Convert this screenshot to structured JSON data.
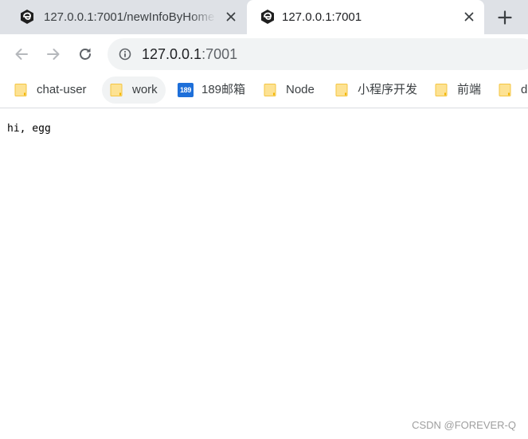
{
  "tabs": [
    {
      "title": "127.0.0.1:7001/newInfoByHome",
      "favicon": "egg-icon",
      "active": false
    },
    {
      "title": "127.0.0.1:7001",
      "favicon": "egg-icon",
      "active": true
    }
  ],
  "toolbar": {
    "url_host": "127.0.0.1",
    "url_port": ":7001"
  },
  "bookmarks": [
    {
      "label": "chat-user",
      "icon": "folder-icon"
    },
    {
      "label": "work",
      "icon": "folder-icon"
    },
    {
      "label": "189邮箱",
      "icon": "189-mail-icon",
      "badge": "189"
    },
    {
      "label": "Node",
      "icon": "folder-icon"
    },
    {
      "label": "小程序开发",
      "icon": "folder-icon"
    },
    {
      "label": "前端",
      "icon": "folder-icon"
    },
    {
      "label": "d",
      "icon": "folder-icon"
    }
  ],
  "page": {
    "body_text": "hi, egg"
  },
  "watermark": "CSDN @FOREVER-Q",
  "colors": {
    "tabstrip": "#dee1e6",
    "omnibox": "#f1f3f4",
    "folder": "#fbd75b",
    "badge_189": "#1e6fd9"
  }
}
